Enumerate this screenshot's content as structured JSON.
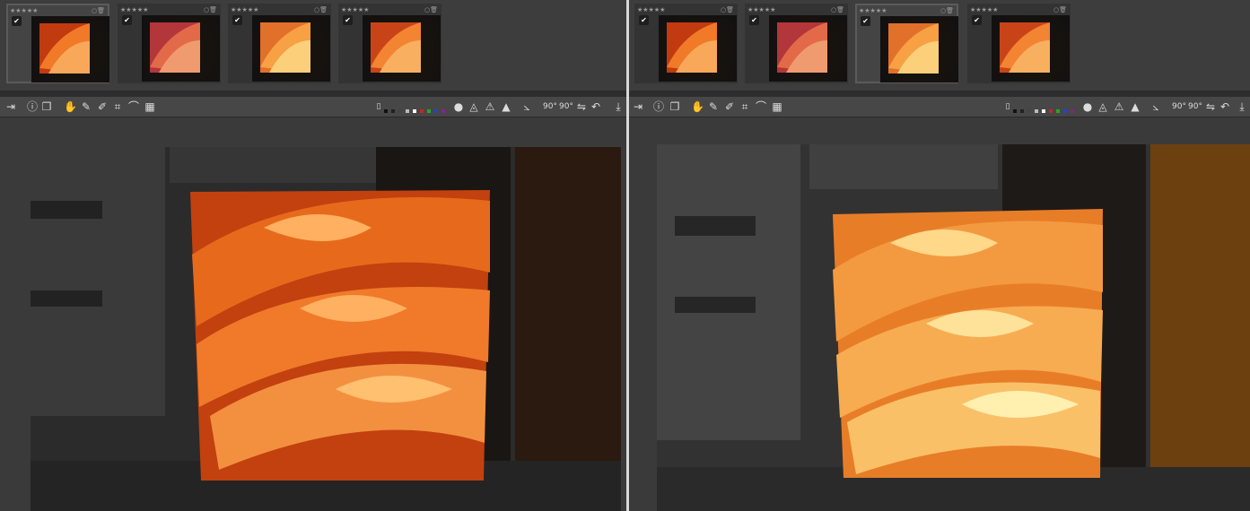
{
  "left_panel": {
    "thumbnails": [
      {
        "rating": "★★★★★",
        "checked": true,
        "selected": true
      },
      {
        "rating": "★★★★★",
        "checked": true,
        "selected": false
      },
      {
        "rating": "★★★★★",
        "checked": true,
        "selected": false
      },
      {
        "rating": "★★★★★",
        "checked": true,
        "selected": false
      }
    ]
  },
  "right_panel": {
    "thumbnails": [
      {
        "rating": "★★★★★",
        "checked": true,
        "selected": false
      },
      {
        "rating": "★★★★★",
        "checked": true,
        "selected": false
      },
      {
        "rating": "★★★★★",
        "checked": true,
        "selected": true
      },
      {
        "rating": "★★★★★",
        "checked": true,
        "selected": false
      }
    ]
  },
  "toolbar": {
    "icons": [
      "panel-toggle-icon",
      "info-icon",
      "before-after-icon",
      "hand-icon",
      "color-picker-icon",
      "white-balance-picker-icon",
      "crop-icon",
      "straighten-icon",
      "grid-icon"
    ],
    "right_icons": [
      "focus-mask-icon",
      "underexposure-icon",
      "overexposure-icon",
      "warning-icon",
      "histogram-icon",
      "rotate-left-icon",
      "rotate-right-icon",
      "flip-icon",
      "undo-icon",
      "fullscreen-icon"
    ],
    "rotate_left_label": "90°",
    "rotate_right_label": "90°"
  },
  "colors": {
    "swatches": [
      "#111111",
      "#222222",
      "#444444",
      "#bbbbbb",
      "#ffffff",
      "#cc2222",
      "#22aa22",
      "#2244cc",
      "#882288"
    ]
  }
}
